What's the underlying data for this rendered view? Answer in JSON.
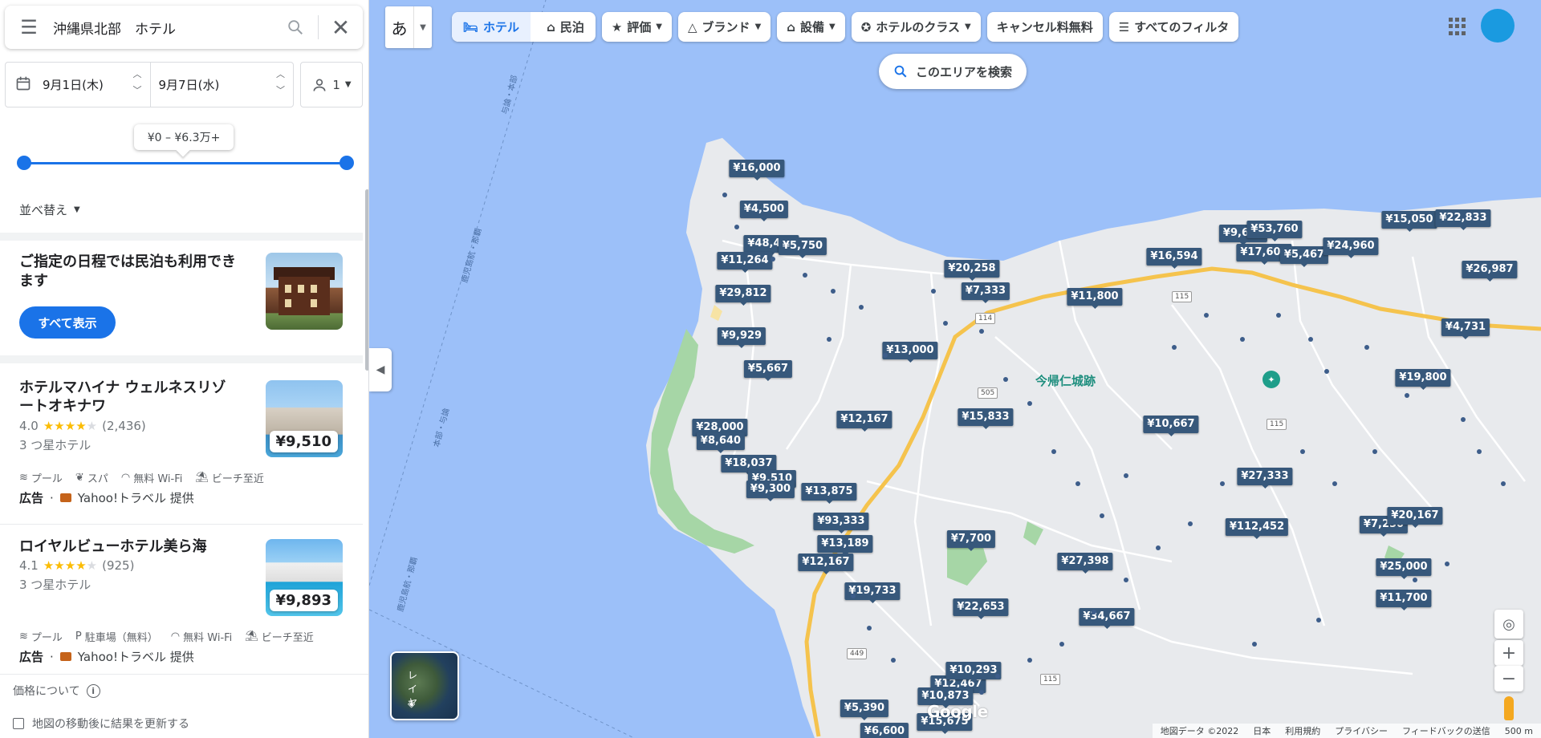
{
  "search": {
    "query": "沖縄県北部　ホテル"
  },
  "dates": {
    "checkin": "9月1日(木)",
    "checkout": "9月7日(水)",
    "guests": "1"
  },
  "price_range": {
    "label": "¥0 – ¥6.3万+",
    "min_fraction": 0,
    "max_fraction": 1
  },
  "sort": {
    "label": "並べ替え"
  },
  "promo": {
    "text": "ご指定の日程では民泊も利用できます",
    "button": "すべて表示"
  },
  "hotels": [
    {
      "name": "ホテルマハイナ ウェルネスリゾートオキナワ",
      "rating": "4.0",
      "stars": 4,
      "reviews": "(2,436)",
      "class": "3 つ星ホテル",
      "price": "¥9,510",
      "amenities": [
        "プール",
        "スパ",
        "無料 Wi-Fi",
        "ビーチ至近"
      ],
      "ad_label": "広告",
      "provider": "Yahoo!トラベル 提供"
    },
    {
      "name": "ロイヤルビューホテル美ら海",
      "rating": "4.1",
      "stars": 4,
      "reviews": "(925)",
      "class": "3 つ星ホテル",
      "price": "¥9,893",
      "amenities": [
        "プール",
        "駐車場（無料）",
        "無料 Wi-Fi",
        "ビーチ至近"
      ],
      "ad_label": "広告",
      "provider": "Yahoo!トラベル 提供"
    }
  ],
  "footer": {
    "price_about": "価格について",
    "update_toggle": "地図の移動後に結果を更新する"
  },
  "map": {
    "ime": "あ",
    "filters": {
      "hotel_tab": "ホテル",
      "minpaku_tab": "民泊",
      "rating": "評価",
      "brand": "ブランド",
      "facilities": "設備",
      "hotel_class": "ホテルのクラス",
      "free_cancel": "キャンセル料無料",
      "all_filters": "すべてのフィルタ"
    },
    "search_area": "このエリアを検索",
    "poi": "今帰仁城跡",
    "layer_label": "レイヤ",
    "logo": "Google",
    "attribution": [
      "地図データ ©2022",
      "日本",
      "利用規約",
      "プライバシー",
      "フィードバックの送信",
      "500 m"
    ],
    "roads": [
      "114",
      "115",
      "505",
      "115",
      "115",
      "449"
    ],
    "sea_labels": [
      "与論・本部",
      "鹿児島航・那覇",
      "本部・与論",
      "鹿児島航・那覇"
    ],
    "price_markers": [
      "¥16,000",
      "¥4,500",
      "¥48,400",
      "¥5,750",
      "¥11,264",
      "¥29,812",
      "¥9,929",
      "¥5,667",
      "¥28,000",
      "¥8,640",
      "¥18,037",
      "¥9,510",
      "¥9,300",
      "¥13,875",
      "¥93,333",
      "¥13,189",
      "¥12,167",
      "¥19,733",
      "¥20,258",
      "¥7,333",
      "¥13,000",
      "¥12,167",
      "¥15,833",
      "¥11,800",
      "¥7,700",
      "¥22,653",
      "¥27,398",
      "¥34,667",
      "¥16,594",
      "¥9,630",
      "¥53,760",
      "¥17,600",
      "¥5,467",
      "¥24,960",
      "¥15,050",
      "¥22,833",
      "¥26,987",
      "¥4,731",
      "¥19,800",
      "¥10,667",
      "¥27,333",
      "¥112,452",
      "¥7,250",
      "¥20,167",
      "¥25,000",
      "¥11,700",
      "¥12,467",
      "¥10,293",
      "¥10,873",
      "¥5,390",
      "¥6,600",
      "¥15,675"
    ]
  }
}
